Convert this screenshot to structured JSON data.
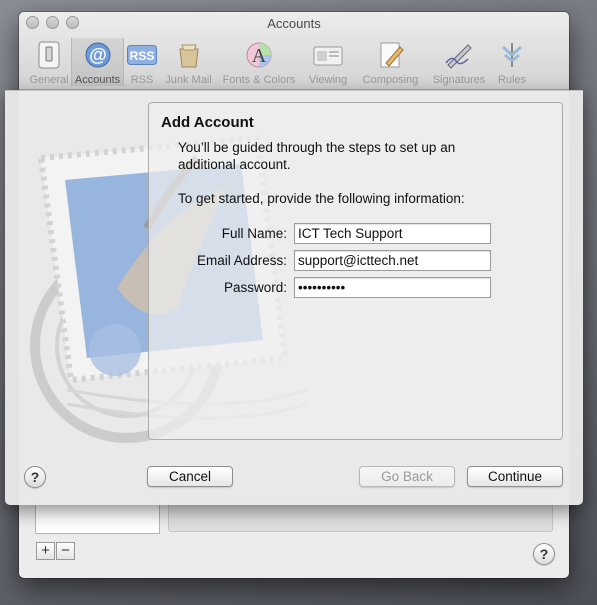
{
  "window": {
    "title": "Accounts"
  },
  "toolbar": {
    "items": [
      {
        "label": "General",
        "icon": "switch-icon"
      },
      {
        "label": "Accounts",
        "icon": "at-sign-icon"
      },
      {
        "label": "RSS",
        "icon": "rss-icon"
      },
      {
        "label": "Junk Mail",
        "icon": "junk-mail-icon"
      },
      {
        "label": "Fonts & Colors",
        "icon": "fonts-colors-icon"
      },
      {
        "label": "Viewing",
        "icon": "viewing-icon"
      },
      {
        "label": "Composing",
        "icon": "composing-icon"
      },
      {
        "label": "Signatures",
        "icon": "signatures-icon"
      },
      {
        "label": "Rules",
        "icon": "rules-icon"
      }
    ],
    "selected": "Accounts"
  },
  "sheet": {
    "title": "Add Account",
    "intro": "You’ll be guided through the steps to set up an additional account.",
    "intro2": "To get started, provide the following information:",
    "fields": {
      "full_name_label": "Full Name:",
      "full_name_value": "ICT Tech Support",
      "email_label": "Email Address:",
      "email_value": "support@icttech.net",
      "password_label": "Password:",
      "password_value": "••••••••••"
    },
    "buttons": {
      "help": "?",
      "cancel": "Cancel",
      "go_back": "Go Back",
      "continue": "Continue"
    }
  },
  "accounts_panel": {
    "add": "+",
    "remove": "−",
    "help": "?"
  },
  "colors": {
    "accent": "#5c8fd6",
    "stamp_blue": "#7f9fd3"
  }
}
